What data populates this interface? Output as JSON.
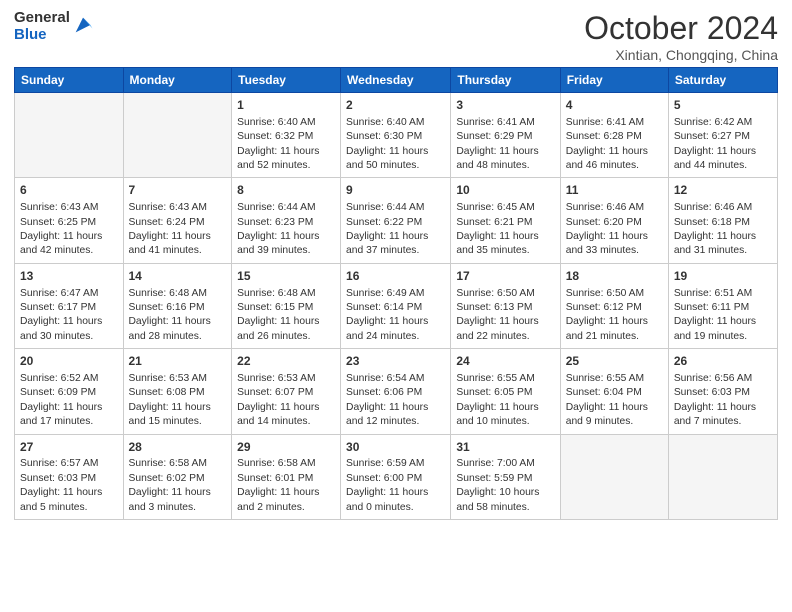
{
  "logo": {
    "general": "General",
    "blue": "Blue"
  },
  "header": {
    "month": "October 2024",
    "location": "Xintian, Chongqing, China"
  },
  "weekdays": [
    "Sunday",
    "Monday",
    "Tuesday",
    "Wednesday",
    "Thursday",
    "Friday",
    "Saturday"
  ],
  "weeks": [
    [
      {
        "day": "",
        "empty": true
      },
      {
        "day": "",
        "empty": true
      },
      {
        "day": "1",
        "sunrise": "Sunrise: 6:40 AM",
        "sunset": "Sunset: 6:32 PM",
        "daylight": "Daylight: 11 hours and 52 minutes."
      },
      {
        "day": "2",
        "sunrise": "Sunrise: 6:40 AM",
        "sunset": "Sunset: 6:30 PM",
        "daylight": "Daylight: 11 hours and 50 minutes."
      },
      {
        "day": "3",
        "sunrise": "Sunrise: 6:41 AM",
        "sunset": "Sunset: 6:29 PM",
        "daylight": "Daylight: 11 hours and 48 minutes."
      },
      {
        "day": "4",
        "sunrise": "Sunrise: 6:41 AM",
        "sunset": "Sunset: 6:28 PM",
        "daylight": "Daylight: 11 hours and 46 minutes."
      },
      {
        "day": "5",
        "sunrise": "Sunrise: 6:42 AM",
        "sunset": "Sunset: 6:27 PM",
        "daylight": "Daylight: 11 hours and 44 minutes."
      }
    ],
    [
      {
        "day": "6",
        "sunrise": "Sunrise: 6:43 AM",
        "sunset": "Sunset: 6:25 PM",
        "daylight": "Daylight: 11 hours and 42 minutes."
      },
      {
        "day": "7",
        "sunrise": "Sunrise: 6:43 AM",
        "sunset": "Sunset: 6:24 PM",
        "daylight": "Daylight: 11 hours and 41 minutes."
      },
      {
        "day": "8",
        "sunrise": "Sunrise: 6:44 AM",
        "sunset": "Sunset: 6:23 PM",
        "daylight": "Daylight: 11 hours and 39 minutes."
      },
      {
        "day": "9",
        "sunrise": "Sunrise: 6:44 AM",
        "sunset": "Sunset: 6:22 PM",
        "daylight": "Daylight: 11 hours and 37 minutes."
      },
      {
        "day": "10",
        "sunrise": "Sunrise: 6:45 AM",
        "sunset": "Sunset: 6:21 PM",
        "daylight": "Daylight: 11 hours and 35 minutes."
      },
      {
        "day": "11",
        "sunrise": "Sunrise: 6:46 AM",
        "sunset": "Sunset: 6:20 PM",
        "daylight": "Daylight: 11 hours and 33 minutes."
      },
      {
        "day": "12",
        "sunrise": "Sunrise: 6:46 AM",
        "sunset": "Sunset: 6:18 PM",
        "daylight": "Daylight: 11 hours and 31 minutes."
      }
    ],
    [
      {
        "day": "13",
        "sunrise": "Sunrise: 6:47 AM",
        "sunset": "Sunset: 6:17 PM",
        "daylight": "Daylight: 11 hours and 30 minutes."
      },
      {
        "day": "14",
        "sunrise": "Sunrise: 6:48 AM",
        "sunset": "Sunset: 6:16 PM",
        "daylight": "Daylight: 11 hours and 28 minutes."
      },
      {
        "day": "15",
        "sunrise": "Sunrise: 6:48 AM",
        "sunset": "Sunset: 6:15 PM",
        "daylight": "Daylight: 11 hours and 26 minutes."
      },
      {
        "day": "16",
        "sunrise": "Sunrise: 6:49 AM",
        "sunset": "Sunset: 6:14 PM",
        "daylight": "Daylight: 11 hours and 24 minutes."
      },
      {
        "day": "17",
        "sunrise": "Sunrise: 6:50 AM",
        "sunset": "Sunset: 6:13 PM",
        "daylight": "Daylight: 11 hours and 22 minutes."
      },
      {
        "day": "18",
        "sunrise": "Sunrise: 6:50 AM",
        "sunset": "Sunset: 6:12 PM",
        "daylight": "Daylight: 11 hours and 21 minutes."
      },
      {
        "day": "19",
        "sunrise": "Sunrise: 6:51 AM",
        "sunset": "Sunset: 6:11 PM",
        "daylight": "Daylight: 11 hours and 19 minutes."
      }
    ],
    [
      {
        "day": "20",
        "sunrise": "Sunrise: 6:52 AM",
        "sunset": "Sunset: 6:09 PM",
        "daylight": "Daylight: 11 hours and 17 minutes."
      },
      {
        "day": "21",
        "sunrise": "Sunrise: 6:53 AM",
        "sunset": "Sunset: 6:08 PM",
        "daylight": "Daylight: 11 hours and 15 minutes."
      },
      {
        "day": "22",
        "sunrise": "Sunrise: 6:53 AM",
        "sunset": "Sunset: 6:07 PM",
        "daylight": "Daylight: 11 hours and 14 minutes."
      },
      {
        "day": "23",
        "sunrise": "Sunrise: 6:54 AM",
        "sunset": "Sunset: 6:06 PM",
        "daylight": "Daylight: 11 hours and 12 minutes."
      },
      {
        "day": "24",
        "sunrise": "Sunrise: 6:55 AM",
        "sunset": "Sunset: 6:05 PM",
        "daylight": "Daylight: 11 hours and 10 minutes."
      },
      {
        "day": "25",
        "sunrise": "Sunrise: 6:55 AM",
        "sunset": "Sunset: 6:04 PM",
        "daylight": "Daylight: 11 hours and 9 minutes."
      },
      {
        "day": "26",
        "sunrise": "Sunrise: 6:56 AM",
        "sunset": "Sunset: 6:03 PM",
        "daylight": "Daylight: 11 hours and 7 minutes."
      }
    ],
    [
      {
        "day": "27",
        "sunrise": "Sunrise: 6:57 AM",
        "sunset": "Sunset: 6:03 PM",
        "daylight": "Daylight: 11 hours and 5 minutes."
      },
      {
        "day": "28",
        "sunrise": "Sunrise: 6:58 AM",
        "sunset": "Sunset: 6:02 PM",
        "daylight": "Daylight: 11 hours and 3 minutes."
      },
      {
        "day": "29",
        "sunrise": "Sunrise: 6:58 AM",
        "sunset": "Sunset: 6:01 PM",
        "daylight": "Daylight: 11 hours and 2 minutes."
      },
      {
        "day": "30",
        "sunrise": "Sunrise: 6:59 AM",
        "sunset": "Sunset: 6:00 PM",
        "daylight": "Daylight: 11 hours and 0 minutes."
      },
      {
        "day": "31",
        "sunrise": "Sunrise: 7:00 AM",
        "sunset": "Sunset: 5:59 PM",
        "daylight": "Daylight: 10 hours and 58 minutes."
      },
      {
        "day": "",
        "empty": true
      },
      {
        "day": "",
        "empty": true
      }
    ]
  ]
}
